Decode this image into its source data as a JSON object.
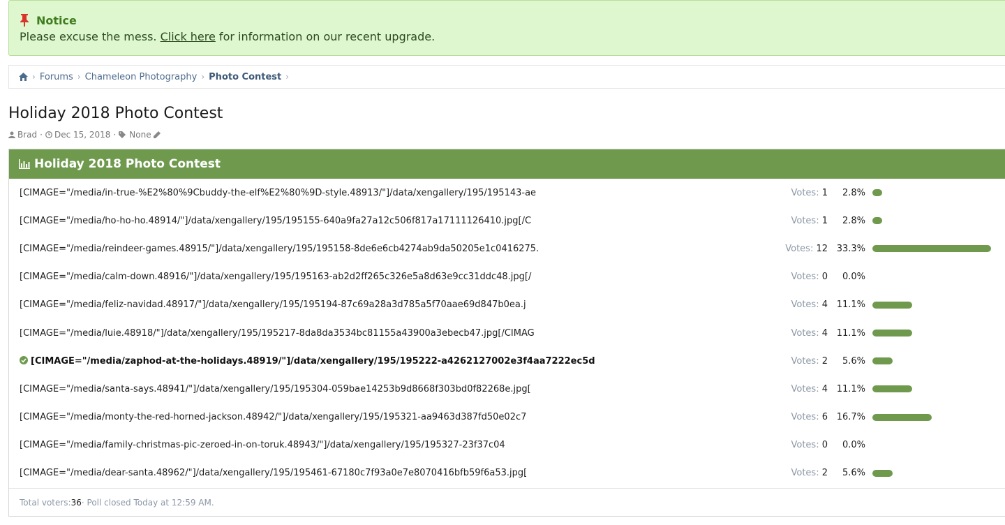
{
  "notice": {
    "title": "Notice",
    "text_before": "Please excuse the mess. ",
    "link": "Click here",
    "text_after": " for information on our recent upgrade."
  },
  "breadcrumb": {
    "items": [
      "Forums",
      "Chameleon Photography"
    ],
    "current": "Photo Contest"
  },
  "thread": {
    "title": "Holiday 2018 Photo Contest",
    "author": "Brad",
    "date": "Dec 15, 2018",
    "tags": "None"
  },
  "poll": {
    "title": "Holiday 2018 Photo Contest",
    "votes_label": "Votes: ",
    "options": [
      {
        "label": "[CIMAGE=\"/media/in-true-%E2%80%9Cbuddy-the-elf%E2%80%9D-style.48913/\"]/data/xengallery/195/195143-ae",
        "votes": "1",
        "percent": "2.8%",
        "fraction": 0.028,
        "winner": false
      },
      {
        "label": "[CIMAGE=\"/media/ho-ho-ho.48914/\"]/data/xengallery/195/195155-640a9fa27a12c506f817a17111126410.jpg[/C",
        "votes": "1",
        "percent": "2.8%",
        "fraction": 0.028,
        "winner": false
      },
      {
        "label": "[CIMAGE=\"/media/reindeer-games.48915/\"]/data/xengallery/195/195158-8de6e6cb4274ab9da50205e1c0416275.",
        "votes": "12",
        "percent": "33.3%",
        "fraction": 0.333,
        "winner": false
      },
      {
        "label": "[CIMAGE=\"/media/calm-down.48916/\"]/data/xengallery/195/195163-ab2d2ff265c326e5a8d63e9cc31ddc48.jpg[/",
        "votes": "0",
        "percent": "0.0%",
        "fraction": 0.0,
        "winner": false
      },
      {
        "label": "[CIMAGE=\"/media/feliz-navidad.48917/\"]/data/xengallery/195/195194-87c69a28a3d785a5f70aae69d847b0ea.j",
        "votes": "4",
        "percent": "11.1%",
        "fraction": 0.111,
        "winner": false
      },
      {
        "label": "[CIMAGE=\"/media/luie.48918/\"]/data/xengallery/195/195217-8da8da3534bc81155a43900a3ebecb47.jpg[/CIMAG",
        "votes": "4",
        "percent": "11.1%",
        "fraction": 0.111,
        "winner": false
      },
      {
        "label": "[CIMAGE=\"/media/zaphod-at-the-holidays.48919/\"]/data/xengallery/195/195222-a4262127002e3f4aa7222ec5d",
        "votes": "2",
        "percent": "5.6%",
        "fraction": 0.056,
        "winner": true
      },
      {
        "label": "[CIMAGE=\"/media/santa-says.48941/\"]/data/xengallery/195/195304-059bae14253b9d8668f303bd0f82268e.jpg[",
        "votes": "4",
        "percent": "11.1%",
        "fraction": 0.111,
        "winner": false
      },
      {
        "label": "[CIMAGE=\"/media/monty-the-red-horned-jackson.48942/\"]/data/xengallery/195/195321-aa9463d387fd50e02c7",
        "votes": "6",
        "percent": "16.7%",
        "fraction": 0.167,
        "winner": false
      },
      {
        "label": "[CIMAGE=\"/media/family-christmas-pic-zeroed-in-on-toruk.48943/\"]/data/xengallery/195/195327-23f37c04",
        "votes": "0",
        "percent": "0.0%",
        "fraction": 0.0,
        "winner": false
      },
      {
        "label": "[CIMAGE=\"/media/dear-santa.48962/\"]/data/xengallery/195/195461-67180c7f93a0e7e8070416bfb59f6a53.jpg[",
        "votes": "2",
        "percent": "5.6%",
        "fraction": 0.056,
        "winner": false
      }
    ],
    "footer_label": "Total voters: ",
    "total_voters": "36",
    "footer_after": " · Poll closed Today at 12:59 AM."
  },
  "colors": {
    "accent": "#6f9a4e",
    "notice_bg": "#dff7cf"
  }
}
